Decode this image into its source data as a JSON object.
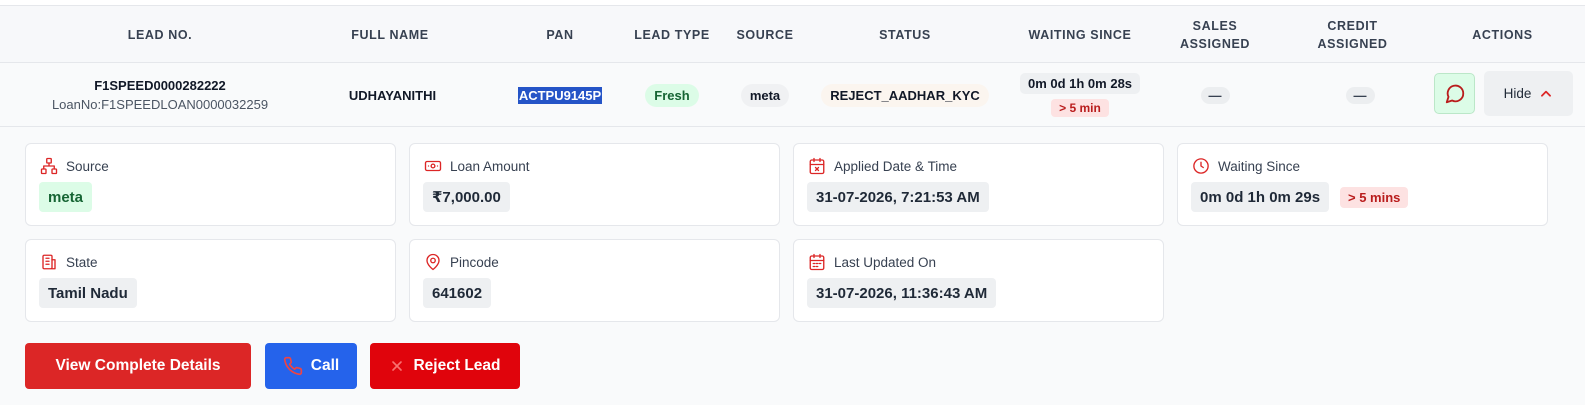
{
  "table": {
    "headers": {
      "lead_no": "LEAD NO.",
      "full_name": "FULL NAME",
      "pan": "PAN",
      "lead_type": "LEAD TYPE",
      "source": "SOURCE",
      "status": "STATUS",
      "waiting_since": "WAITING SINCE",
      "sales_assigned_1": "SALES",
      "sales_assigned_2": "ASSIGNED",
      "credit_assigned_1": "CREDIT",
      "credit_assigned_2": "ASSIGNED",
      "actions": "ACTIONS"
    },
    "row": {
      "lead_no": "F1SPEED0000282222",
      "loan_no": "LoanNo:F1SPEEDLOAN0000032259",
      "full_name": "UDHAYANITHI",
      "pan": "ACTPU9145P",
      "lead_type": "Fresh",
      "source": "meta",
      "status": "REJECT_AADHAR_KYC",
      "waiting_time": "0m 0d 1h 0m 28s",
      "waiting_badge": "> 5 min",
      "sales_assigned": "—",
      "credit_assigned": "—",
      "hide_label": "Hide"
    }
  },
  "details": {
    "source": {
      "label": "Source",
      "value": "meta"
    },
    "loan_amount": {
      "label": "Loan Amount",
      "value": "₹7,000.00"
    },
    "applied": {
      "label": "Applied Date & Time",
      "value": "31-07-2026, 7:21:53 AM"
    },
    "waiting": {
      "label": "Waiting Since",
      "value": "0m 0d 1h 0m 29s",
      "badge": "> 5 mins"
    },
    "state": {
      "label": "State",
      "value": "Tamil Nadu"
    },
    "pincode": {
      "label": "Pincode",
      "value": "641602"
    },
    "last_updated": {
      "label": "Last Updated On",
      "value": "31-07-2026, 11:36:43 AM"
    }
  },
  "buttons": {
    "view": "View Complete Details",
    "call": "Call",
    "reject": "Reject Lead"
  },
  "colors": {
    "accent_red": "#dc2626",
    "call_blue": "#2563eb",
    "fresh_green": "#166534",
    "badge_red": "#b91c1c"
  }
}
